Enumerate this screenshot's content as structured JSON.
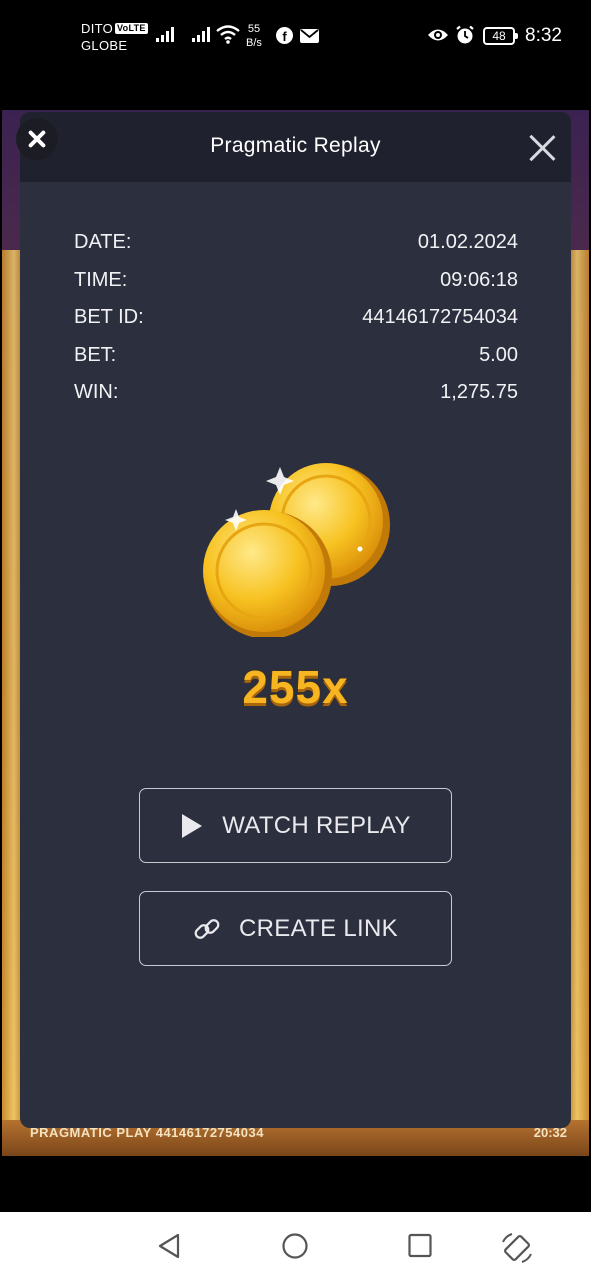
{
  "status_bar": {
    "carrier_1": "DITO",
    "volte": "VoLTE",
    "carrier_2": "GLOBE",
    "net_speed_value": "55",
    "net_speed_unit": "B/s",
    "battery": "48",
    "time": "8:32"
  },
  "modal": {
    "title": "Pragmatic Replay",
    "details": [
      {
        "label": "DATE:",
        "value": "01.02.2024"
      },
      {
        "label": "TIME:",
        "value": "09:06:18"
      },
      {
        "label": "BET ID:",
        "value": "44146172754034"
      },
      {
        "label": "BET:",
        "value": "5.00"
      },
      {
        "label": "WIN:",
        "value": "1,275.75"
      }
    ],
    "multiplier": "255x",
    "watch_replay_label": "WATCH REPLAY",
    "create_link_label": "CREATE LINK"
  },
  "game_footer": {
    "text": "PRAGMATIC PLAY  44146172754034",
    "time": "20:32"
  },
  "colors": {
    "modal_bg": "#2b2f3e",
    "header_bg": "#1f222e",
    "multiplier": "#f7b522"
  }
}
